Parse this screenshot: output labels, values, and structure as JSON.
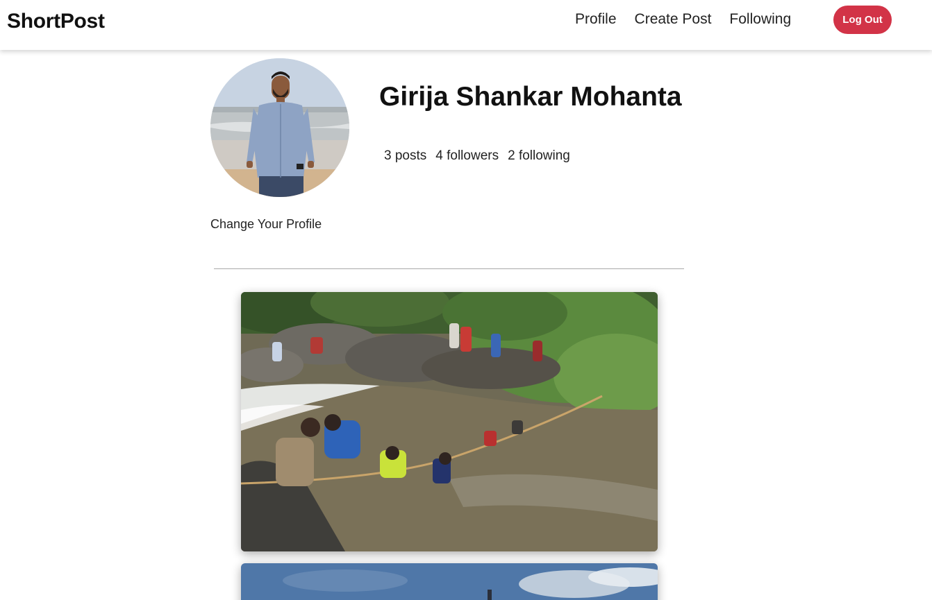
{
  "app": {
    "brand": "ShortPost"
  },
  "nav": {
    "links": [
      "Profile",
      "Create Post",
      "Following"
    ],
    "logout_label": "Log Out"
  },
  "profile": {
    "name": "Girija Shankar Mohanta",
    "stats": {
      "posts": "3 posts",
      "followers": "4 followers",
      "following": "2 following"
    },
    "change_profile_label": "Change Your Profile"
  },
  "colors": {
    "accent": "#d23347",
    "divider": "#a8a8a8",
    "background": "#ffffff"
  },
  "icons": []
}
